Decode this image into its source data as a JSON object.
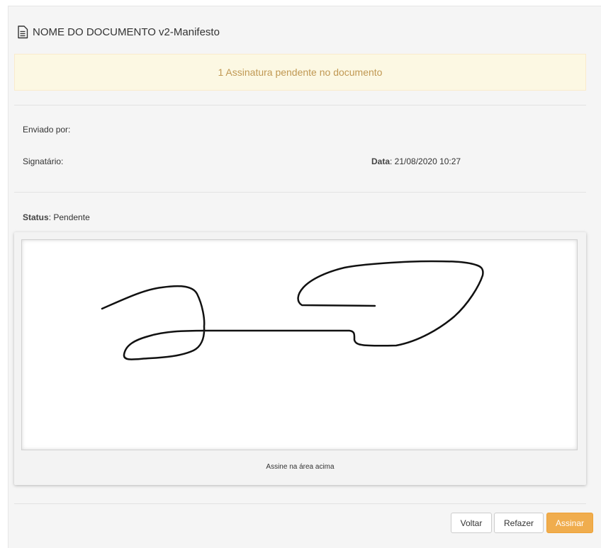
{
  "document": {
    "title": "NOME DO DOCUMENTO v2-Manifesto",
    "icon": "document-icon"
  },
  "alert": {
    "text": "1 Assinatura pendente no documento",
    "color": "#c09853",
    "background": "#fcf8e3"
  },
  "info": {
    "sender_label": "Enviado por:",
    "signer_label": "Signatário:",
    "date_label": "Data",
    "date_value": ": 21/08/2020 10:27"
  },
  "status": {
    "label": "Status",
    "value": ": Pendente"
  },
  "signature_pad": {
    "hint": "Assine na área acima",
    "stroke_color": "#111111"
  },
  "buttons": {
    "back": "Voltar",
    "redo": "Refazer",
    "sign": "Assinar",
    "sign_color": "#f0ad4e"
  }
}
